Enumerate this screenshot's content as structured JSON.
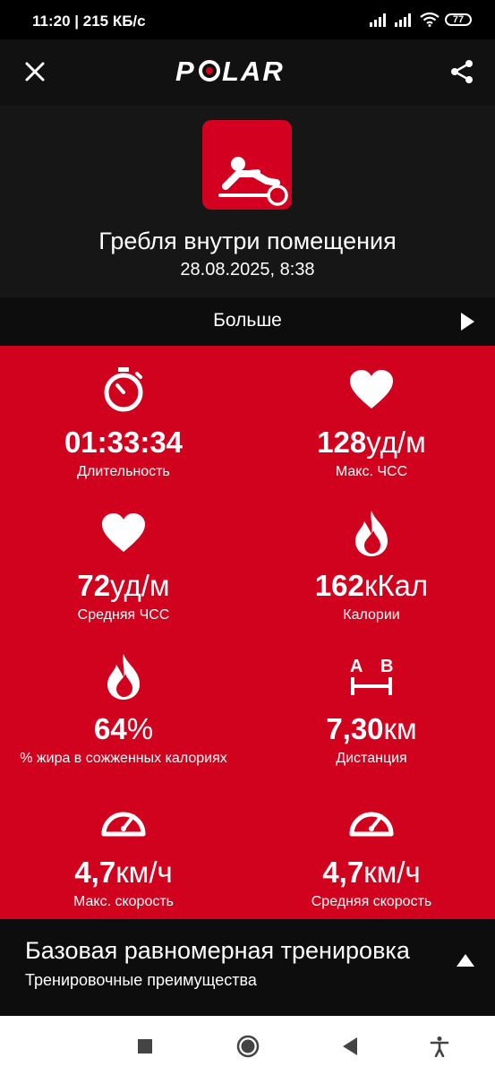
{
  "status_bar": {
    "time": "11:20 | 215 КБ/с",
    "battery": "77"
  },
  "app_bar": {
    "logo_text": "POLAR",
    "close_icon": "close-icon",
    "share_icon": "share-icon"
  },
  "header": {
    "sport_icon": "rowing-icon",
    "title": "Гребля внутри помещения",
    "datetime": "28.08.2025, 8:38"
  },
  "more": {
    "label": "Больше"
  },
  "stats": [
    {
      "icon": "stopwatch-icon",
      "value": "01:33:34",
      "unit": "",
      "label": "Длительность"
    },
    {
      "icon": "heart-icon",
      "value": "128",
      "unit": "уд/м",
      "label": "Макс. ЧСС"
    },
    {
      "icon": "heart-icon",
      "value": "72",
      "unit": "уд/м",
      "label": "Средняя ЧСС"
    },
    {
      "icon": "flame-icon",
      "value": "162",
      "unit": "кКал",
      "label": "Калории"
    },
    {
      "icon": "flame-icon",
      "value": "64",
      "unit": "%",
      "label": "% жира в сожженных калориях"
    },
    {
      "icon": "distance-icon",
      "value": "7,30",
      "unit": "км",
      "label": "Дистанция"
    },
    {
      "icon": "speedometer-icon",
      "value": "4,7",
      "unit": "км/ч",
      "label": "Макс. скорость"
    },
    {
      "icon": "speedometer-icon",
      "value": "4,7",
      "unit": "км/ч",
      "label": "Средняя скорость"
    }
  ],
  "training": {
    "title": "Базовая равномерная тренировка",
    "subtitle": "Тренировочные преимущества"
  },
  "colors": {
    "accent": "#d0021e",
    "dark": "#161616"
  }
}
